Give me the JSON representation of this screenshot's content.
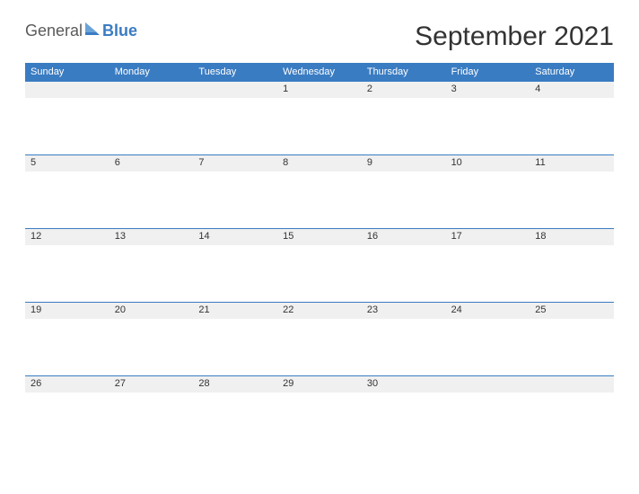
{
  "logo": {
    "text_general": "General",
    "text_blue": "Blue"
  },
  "title": "September 2021",
  "days_of_week": [
    "Sunday",
    "Monday",
    "Tuesday",
    "Wednesday",
    "Thursday",
    "Friday",
    "Saturday"
  ],
  "weeks": [
    [
      "",
      "",
      "",
      "1",
      "2",
      "3",
      "4"
    ],
    [
      "5",
      "6",
      "7",
      "8",
      "9",
      "10",
      "11"
    ],
    [
      "12",
      "13",
      "14",
      "15",
      "16",
      "17",
      "18"
    ],
    [
      "19",
      "20",
      "21",
      "22",
      "23",
      "24",
      "25"
    ],
    [
      "26",
      "27",
      "28",
      "29",
      "30",
      "",
      ""
    ]
  ]
}
